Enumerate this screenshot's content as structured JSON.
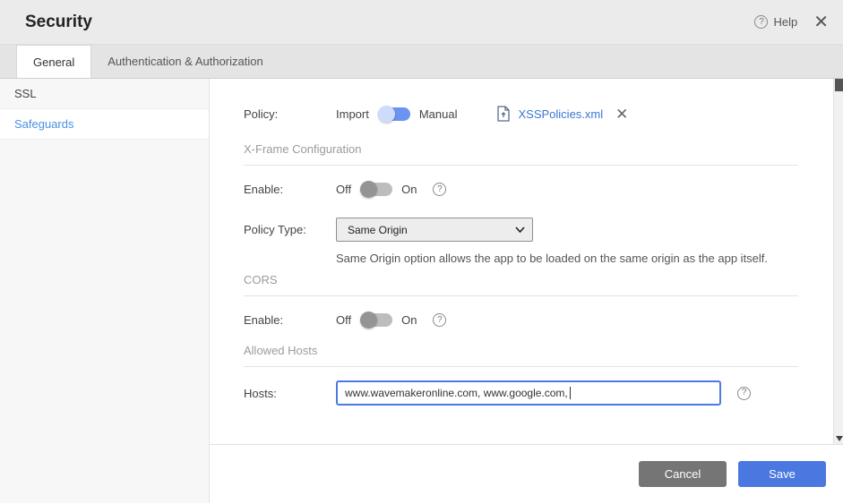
{
  "header": {
    "title": "Security",
    "help_label": "Help"
  },
  "icons": {
    "help_glyph": "?",
    "close_glyph": "✕",
    "remove_glyph": "✕"
  },
  "tabs": [
    {
      "label": "General",
      "active": true
    },
    {
      "label": "Authentication & Authorization",
      "active": false
    }
  ],
  "sidebar": {
    "items": [
      {
        "label": "SSL",
        "selected": false
      },
      {
        "label": "Safeguards",
        "selected": true
      }
    ]
  },
  "content": {
    "policy_row": {
      "label": "Policy:",
      "left_option": "Import",
      "right_option": "Manual",
      "toggle_state": "Import",
      "file_name": "XSSPolicies.xml"
    },
    "xframe": {
      "section_title": "X-Frame Configuration",
      "enable_label": "Enable:",
      "off_label": "Off",
      "on_label": "On",
      "enable_state": "Off",
      "policy_type_label": "Policy Type:",
      "policy_type_value": "Same Origin",
      "helper_text": "Same Origin option allows the app to be loaded on the same origin as the app itself."
    },
    "cors": {
      "section_title": "CORS",
      "enable_label": "Enable:",
      "off_label": "Off",
      "on_label": "On",
      "enable_state": "Off"
    },
    "allowed_hosts": {
      "section_title": "Allowed Hosts",
      "hosts_label": "Hosts:",
      "hosts_value": "www.wavemakeronline.com, www.google.com, "
    }
  },
  "footer": {
    "cancel_label": "Cancel",
    "save_label": "Save"
  },
  "colors": {
    "accent_blue": "#4a78e0",
    "link_blue": "#3a77d2",
    "toggle_on": "#6b93ef",
    "toggle_off": "#bdbdbd",
    "selected_sidebar_text": "#4a90e2",
    "cancel_gray": "#757575"
  }
}
